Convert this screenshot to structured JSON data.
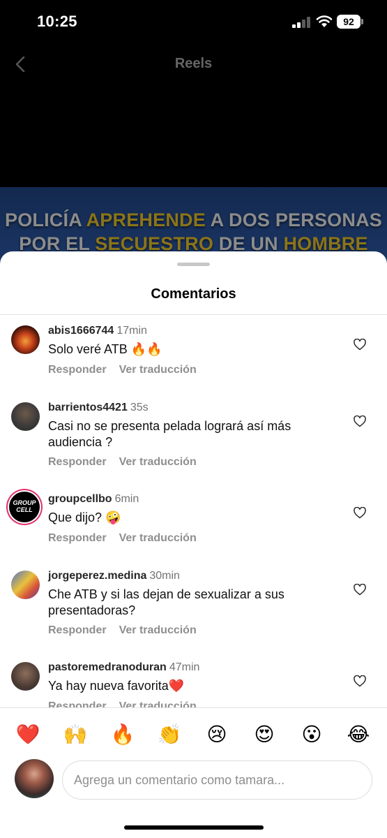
{
  "status_bar": {
    "time": "10:25",
    "battery": "92"
  },
  "header": {
    "title": "Reels"
  },
  "video": {
    "headline_line1": [
      {
        "text": "POLICÍA ",
        "highlight": false
      },
      {
        "text": "APREHENDE",
        "highlight": true
      },
      {
        "text": " A DOS PERSONAS",
        "highlight": false
      }
    ],
    "headline_line2": [
      {
        "text": "POR EL ",
        "highlight": false
      },
      {
        "text": "SECUESTRO",
        "highlight": true
      },
      {
        "text": " DE UN ",
        "highlight": false
      },
      {
        "text": "HOMBRE",
        "highlight": true
      }
    ]
  },
  "sheet": {
    "title": "Comentarios",
    "comments": [
      {
        "user": "abis1666744",
        "time": "17min",
        "text": "Solo veré ATB 🔥🔥",
        "reply": "Responder",
        "translate": "Ver traducción"
      },
      {
        "user": "barrientos4421",
        "time": "35s",
        "text": "Casi no se presenta pelada  logrará así más audiencia ?",
        "reply": "Responder",
        "translate": "Ver traducción"
      },
      {
        "user": "groupcellbo",
        "time": "6min",
        "text": "Que dijo? 🤪",
        "reply": "Responder",
        "translate": "Ver traducción",
        "avatar_text": "GROUP CELL"
      },
      {
        "user": "jorgeperez.medina",
        "time": "30min",
        "text": "Che ATB y si las dejan de sexualizar a sus presentadoras?",
        "reply": "Responder",
        "translate": "Ver traducción"
      },
      {
        "user": "pastoremedranoduran",
        "time": "47min",
        "text": "Ya hay nueva favorita❤️",
        "reply": "Responder",
        "translate": "Ver traducción"
      }
    ]
  },
  "emoji_bar": [
    "❤️",
    "🙌",
    "🔥",
    "👏",
    "😢",
    "😍",
    "😮",
    "😂"
  ],
  "composer": {
    "placeholder": "Agrega un comentario como tamara..."
  },
  "colors": {
    "highlight": "#8c7418",
    "banner": "#13294f",
    "muted": "#8e8e8e"
  }
}
